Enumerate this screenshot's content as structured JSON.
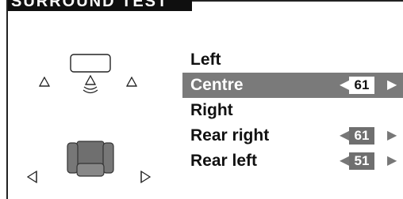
{
  "title": "SURROUND TEST",
  "menu": {
    "items": [
      {
        "label": "Left"
      },
      {
        "label": "Centre",
        "value": "61"
      },
      {
        "label": "Right"
      },
      {
        "label": "Rear right",
        "value": "61"
      },
      {
        "label": "Rear left",
        "value": "51"
      }
    ]
  },
  "icons": {
    "tv": "tv-icon",
    "front_left": "speaker-front-left-icon",
    "centre": "speaker-centre-active-icon",
    "front_right": "speaker-front-right-icon",
    "seat": "listening-seat-icon",
    "rear_left": "speaker-rear-left-icon",
    "rear_right": "speaker-rear-right-icon"
  },
  "colors": {
    "selected_row": "#7a7a7a",
    "title_bg": "#0f0f0f"
  }
}
